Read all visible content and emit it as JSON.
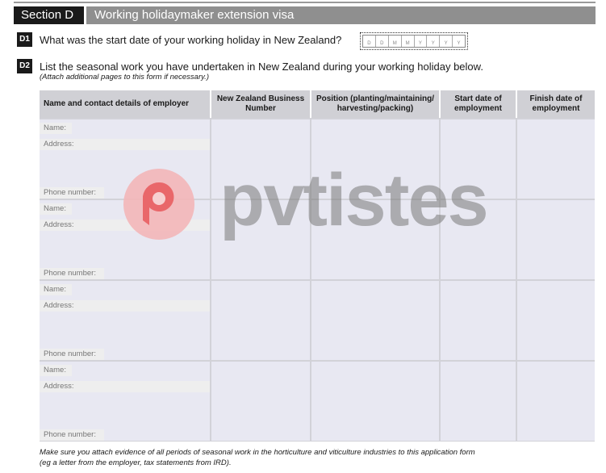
{
  "section": {
    "label": "Section D",
    "title": "Working holidaymaker extension visa"
  },
  "questions": {
    "d1": {
      "number": "D1",
      "text": "What was the start date of your working holiday in New Zealand?"
    },
    "d2": {
      "number": "D2",
      "text": "List the seasonal work you have undertaken in New Zealand during your working holiday below.",
      "note": "(Attach additional pages to this form if necessary.)"
    }
  },
  "date_cells": [
    "D",
    "D",
    "M",
    "M",
    "Y",
    "Y",
    "Y",
    "Y"
  ],
  "table": {
    "headers": [
      "Name and contact details of employer",
      "New Zealand Business Number",
      "Position (planting/maintaining/ harvesting/packing)",
      "Start date of employment",
      "Finish date of employment"
    ],
    "field_labels": {
      "name": "Name:",
      "address": "Address:",
      "phone": "Phone number:"
    }
  },
  "footer": {
    "line1": "Make sure you attach evidence of all periods of seasonal work in the horticulture and viticulture industries to this application form",
    "line2": "(eg a letter from the employer, tax statements from IRD)."
  },
  "watermark": {
    "text": "pvtistes",
    "color": "#e8585c"
  }
}
